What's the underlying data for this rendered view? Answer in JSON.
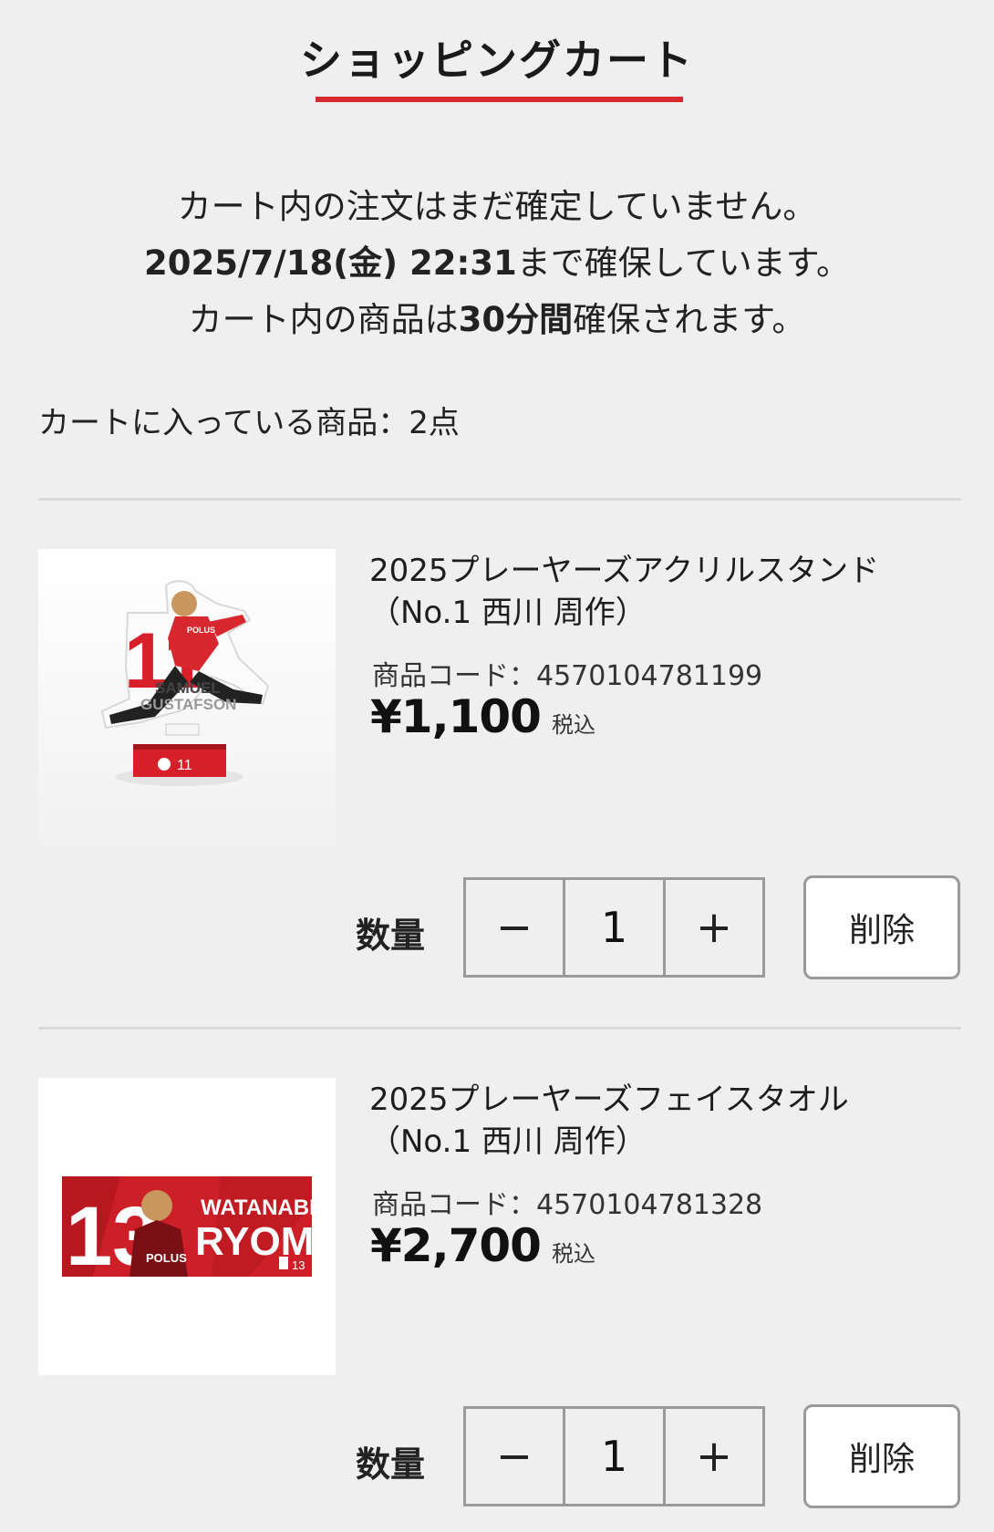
{
  "header": {
    "title": "ショッピングカート",
    "accent_color": "#d7282f"
  },
  "notice": {
    "line1": "カート内の注文はまだ確定していません。",
    "line2_deadline": "2025/7/18(金) 22:31",
    "line2_suffix": "まで確保しています。",
    "line3_prefix": "カート内の商品は",
    "line3_duration": "30分間",
    "line3_suffix": "確保されます。"
  },
  "cart": {
    "count_label": "カートに入っている商品：2点"
  },
  "items": [
    {
      "name_line1": "2025プレーヤーズアクリルスタンド",
      "name_line2": "（No.1 西川 周作）",
      "code": "商品コード：4570104781199",
      "price": "¥1,100",
      "tax": "税込",
      "qty_label": "数量",
      "minus": "−",
      "quantity": "1",
      "plus": "+",
      "delete": "削除",
      "image": {
        "number": "11",
        "first": "SAMUEL",
        "last": "GUSTAFSON",
        "brand": "POLUS",
        "base_number": "11"
      }
    },
    {
      "name_line1": "2025プレーヤーズフェイスタオル",
      "name_line2": "（No.1 西川 周作）",
      "code": "商品コード：4570104781328",
      "price": "¥2,700",
      "tax": "税込",
      "qty_label": "数量",
      "minus": "−",
      "quantity": "1",
      "plus": "+",
      "delete": "削除",
      "image": {
        "number": "13",
        "first": "WATANABE",
        "last": "RYOMA",
        "brand": "POLUS",
        "badge_number": "13"
      }
    }
  ]
}
